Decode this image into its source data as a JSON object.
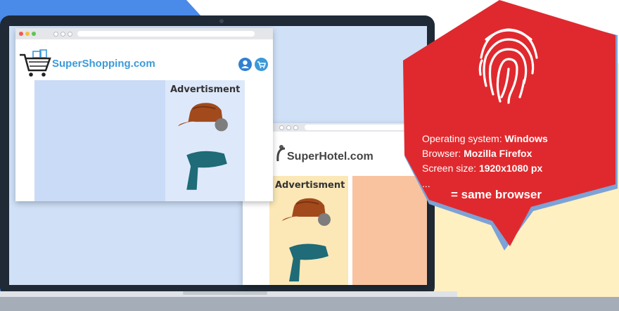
{
  "colors": {
    "bg_blue": "#4a8ae8",
    "bg_cream": "#fff0c2",
    "bubble_red": "#e0292e",
    "brand_blue": "#3b9ad9",
    "ad_panel_blue": "#dde9fa",
    "content_blue": "#c9dbf7",
    "ad_panel_cream": "#fbe8b6",
    "content_peach": "#f9c3a0",
    "hat_brown": "#a24a1c",
    "scarf_teal": "#1f6b78"
  },
  "shopping_window": {
    "brand": "SuperShopping.com",
    "logo_icon": "shopping-cart-icon",
    "user_icon": "user-icon",
    "cart_icon": "cart-icon",
    "ad_title": "Advertisment"
  },
  "hotel_window": {
    "brand": "SuperHotel.com",
    "logo_icon": "bell-icon",
    "ad_title": "Advertisment"
  },
  "fingerprint": {
    "icon": "fingerprint-icon",
    "lines": [
      {
        "label": "Operating system: ",
        "value": "Windows"
      },
      {
        "label": "Browser: ",
        "value": "Mozilla Firefox"
      },
      {
        "label": "Screen size: ",
        "value": "1920x1080 px"
      }
    ],
    "ellipsis": "...",
    "conclusion": "= same browser"
  }
}
